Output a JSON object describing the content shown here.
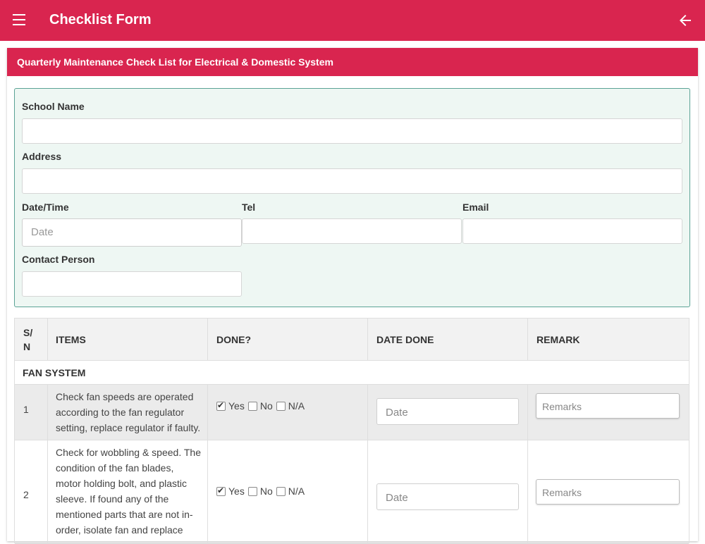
{
  "appbar": {
    "title": "Checklist Form",
    "background": "#d9254f"
  },
  "form": {
    "heading": "Quarterly Maintenance Check List for Electrical & Domestic System",
    "fields": {
      "school_name_label": "School Name",
      "address_label": "Address",
      "datetime_label": "Date/Time",
      "datetime_placeholder": "Date",
      "tel_label": "Tel",
      "email_label": "Email",
      "contact_label": "Contact Person"
    }
  },
  "table": {
    "headers": {
      "sn_line1": "S/",
      "sn_line2": "N",
      "items": "ITEMS",
      "done": "DONE?",
      "date_done": "DATE DONE",
      "remark": "REMARK"
    },
    "section": "FAN SYSTEM",
    "option_labels": {
      "yes": "Yes",
      "no": "No",
      "na": "N/A"
    },
    "rows": [
      {
        "sn": "1",
        "lines": [
          "Check fan speeds are operated",
          "according to the fan regulator",
          "setting, replace regulator if faulty."
        ],
        "done": "yes",
        "date_placeholder": "Date",
        "remark_placeholder": "Remarks"
      },
      {
        "sn": "2",
        "lines": [
          "Check for wobbling & speed. The",
          "condition of the fan blades,",
          "motor holding bolt, and plastic",
          "sleeve. If found any of the",
          "mentioned parts that are not in-",
          "order, isolate fan and replace"
        ],
        "done": "yes",
        "date_placeholder": "Date",
        "remark_placeholder": "Remarks"
      }
    ]
  }
}
